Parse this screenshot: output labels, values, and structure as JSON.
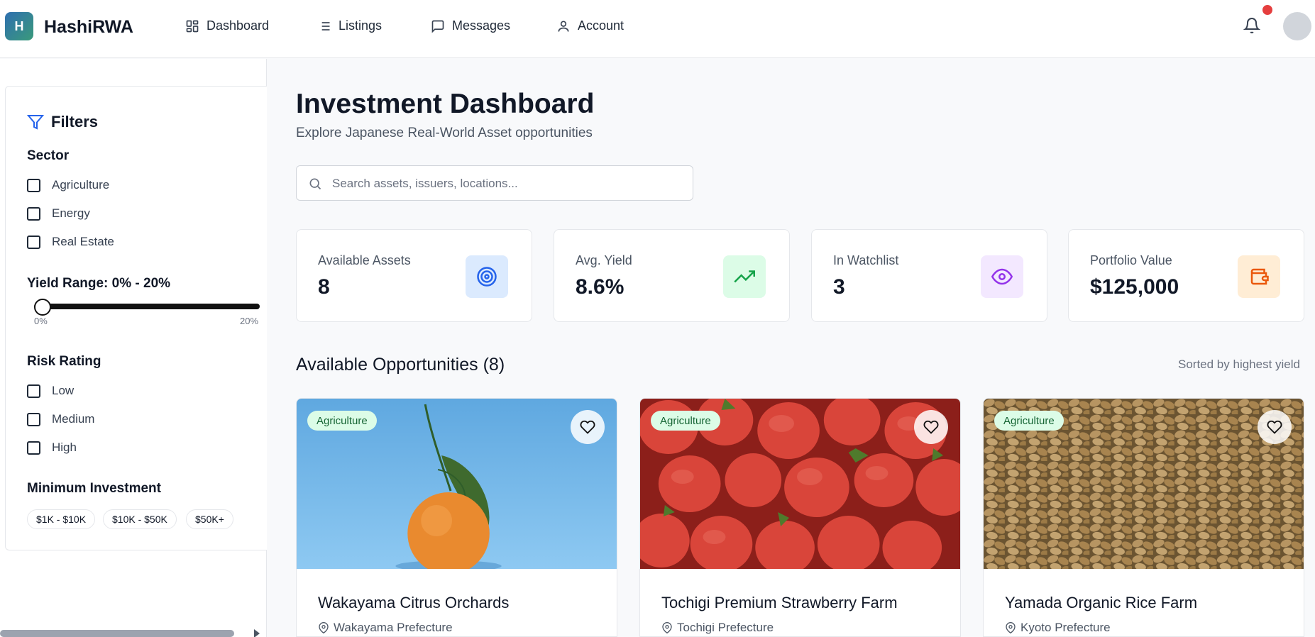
{
  "brand": {
    "logo_letter": "H",
    "name": "HashiRWA"
  },
  "nav": {
    "items": [
      {
        "label": "Dashboard",
        "icon": "dashboard-grid-icon"
      },
      {
        "label": "Listings",
        "icon": "list-icon"
      },
      {
        "label": "Messages",
        "icon": "message-square-icon"
      },
      {
        "label": "Account",
        "icon": "user-icon"
      }
    ],
    "notification_icon": "bell-icon"
  },
  "filters": {
    "title": "Filters",
    "sector": {
      "label": "Sector",
      "options": [
        "Agriculture",
        "Energy",
        "Real Estate"
      ]
    },
    "yield": {
      "label": "Yield Range: 0% - 20%",
      "min_label": "0%",
      "max_label": "20%",
      "min_value": 0,
      "max_value": 20
    },
    "risk": {
      "label": "Risk Rating",
      "options": [
        "Low",
        "Medium",
        "High"
      ]
    },
    "min_investment": {
      "label": "Minimum Investment",
      "options": [
        "$1K - $10K",
        "$10K - $50K",
        "$50K+"
      ]
    }
  },
  "main": {
    "title": "Investment Dashboard",
    "subtitle": "Explore Japanese Real-World Asset opportunities",
    "search_placeholder": "Search assets, issuers, locations...",
    "stats": [
      {
        "label": "Available Assets",
        "value": "8",
        "icon": "target-icon",
        "accent": "#2563eb",
        "bg": "#dbeafe"
      },
      {
        "label": "Avg. Yield",
        "value": "8.6%",
        "icon": "trending-up-icon",
        "accent": "#16a34a",
        "bg": "#dcfce7"
      },
      {
        "label": "In Watchlist",
        "value": "3",
        "icon": "eye-icon",
        "accent": "#9333ea",
        "bg": "#f3e8ff"
      },
      {
        "label": "Portfolio Value",
        "value": "$125,000",
        "icon": "wallet-icon",
        "accent": "#ea580c",
        "bg": "#ffedd5"
      }
    ],
    "opportunities_title": "Available Opportunities (8)",
    "sort_note": "Sorted by highest yield",
    "listings": [
      {
        "sector": "Agriculture",
        "title": "Wakayama Citrus Orchards",
        "location": "Wakayama Prefecture",
        "image": "mandarin-orange-photo"
      },
      {
        "sector": "Agriculture",
        "title": "Tochigi Premium Strawberry Farm",
        "location": "Tochigi Prefecture",
        "image": "strawberries-photo"
      },
      {
        "sector": "Agriculture",
        "title": "Yamada Organic Rice Farm",
        "location": "Kyoto Prefecture",
        "image": "grain-photo"
      }
    ]
  }
}
